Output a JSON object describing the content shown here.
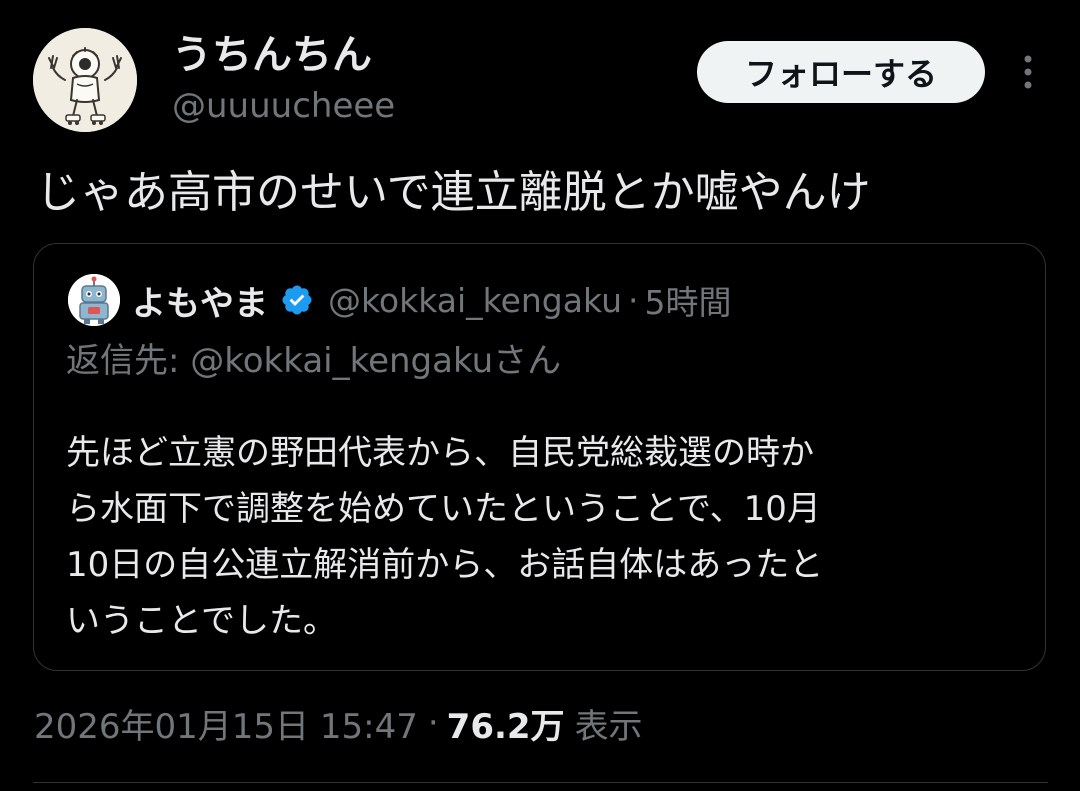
{
  "author": {
    "name": "うちんちん",
    "handle": "@uuuucheee",
    "avatar_icon": "doodle-character-avatar"
  },
  "header": {
    "follow_label": "フォローする",
    "more_icon": "more-vertical-icon"
  },
  "tweet": {
    "text": "じゃあ高市のせいで連立離脱とか嘘やんけ"
  },
  "quote": {
    "avatar_icon": "robot-avatar",
    "name": "よもやま",
    "verified_icon": "verified-badge-icon",
    "handle": "@kokkai_kengaku",
    "dot": "·",
    "time": "5時間",
    "reply_to": "返信先: @kokkai_kengakuさん",
    "body_lines": [
      "先ほど立憲の野田代表から、自民党総裁選の時か",
      "ら水面下で調整を始めていたということで、10月",
      "10日の自公連立解消前から、お話自体はあったと",
      "いうことでした。"
    ]
  },
  "meta": {
    "timestamp": "2026年01月15日 15:47",
    "separator": "·",
    "views_count": "76.2万",
    "views_label": "表示"
  },
  "colors": {
    "background": "#000000",
    "text_primary": "#e7e9ea",
    "text_secondary": "#71767b",
    "border": "#2f3336",
    "verified_blue": "#1d9bf0",
    "follow_bg": "#eff3f4"
  }
}
